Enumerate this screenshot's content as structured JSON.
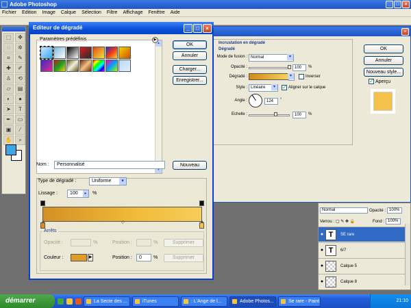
{
  "app": {
    "title": "Adobe Photoshop",
    "menu": [
      "Fichier",
      "Edition",
      "Image",
      "Calque",
      "Sélection",
      "Filtre",
      "Affichage",
      "Fenêtre",
      "Aide"
    ]
  },
  "gradient_editor": {
    "title": "Editeur de dégradé",
    "presets_label": "Paramètres prédéfinis",
    "presets": [
      {
        "colors": [
          "#c9e8ff",
          "#38a6ee"
        ]
      },
      {
        "colors": [
          "#7ab7e0",
          "#ffffff"
        ]
      },
      {
        "colors": [
          "#000000",
          "#ffffff"
        ]
      },
      {
        "colors": [
          "#d62020",
          "#2a2a2a"
        ]
      },
      {
        "colors": [
          "#e04a18",
          "#f1e23c"
        ]
      },
      {
        "colors": [
          "#2830c8",
          "#ef3a14",
          "#f6d23a"
        ]
      },
      {
        "colors": [
          "#f4d200",
          "#d05000"
        ]
      },
      {
        "colors": [
          "#3a2cc8",
          "#e02c8c"
        ]
      },
      {
        "colors": [
          "#d01818",
          "#18a020",
          "#f4d000"
        ]
      },
      {
        "colors": [
          "#6a5a1a",
          "#f0f0e0",
          "#6a5a1a"
        ]
      },
      {
        "colors": [
          "#7a2a10",
          "#f0c080",
          "#7a2a10"
        ]
      },
      {
        "colors": [
          "#ff0000",
          "#ffff00",
          "#00ff00",
          "#00ffff",
          "#0000ff",
          "#ff00ff"
        ]
      },
      {
        "colors": [
          "#ff00a0",
          "#00a0ff",
          "#a0ff00"
        ]
      },
      {
        "colors": [
          "#b8d8f0",
          "#e0f0ff"
        ]
      }
    ],
    "buttons": {
      "ok": "OK",
      "cancel": "Annuler",
      "load": "Charger...",
      "save": "Enregistrer...",
      "new": "Nouveau"
    },
    "name_label": "Nom :",
    "name_value": "Personnalisé",
    "gradient_type_label": "Type de dégradé :",
    "gradient_type_value": "Uniforme",
    "smoothness_label": "Lissage :",
    "smoothness_value": "100",
    "smoothness_unit": "%",
    "stops_title": "Arrêts",
    "opacity_label": "Opacité :",
    "opacity_unit": "%",
    "location_label": "Position :",
    "location_unit": "%",
    "delete_label": "Supprimer",
    "color_label": "Couleur :",
    "color_location_value": "0",
    "stop_color": "#e09c28"
  },
  "layer_style": {
    "section": "Incrustation en dégradé",
    "subsection": "Dégradé",
    "blend_mode_label": "Mode de fusion :",
    "blend_mode_value": "Normal",
    "opacity_label": "Opacité :",
    "opacity_value": "100",
    "gradient_label": "Dégradé :",
    "reverse_label": "Inverser",
    "style_label": "Style :",
    "style_value": "Linéaire",
    "align_label": "Aligner sur le calque",
    "angle_label": "Angle :",
    "angle_value": "124",
    "angle_unit": "°",
    "scale_label": "Echelle :",
    "scale_value": "100",
    "percent": "%",
    "buttons": {
      "ok": "OK",
      "cancel": "Annuler",
      "new_style": "Nouveau style...",
      "preview": "Aperçu"
    }
  },
  "layers_panel": {
    "blend_mode": "Normal",
    "opacity_label": "Opacité :",
    "opacity_value": "100%",
    "lock_label": "Verrou :",
    "fill_label": "Fond :",
    "fill_value": "100%",
    "layers": [
      {
        "name": "SE rare",
        "type": "text",
        "selected": true
      },
      {
        "name": "6/7",
        "type": "text",
        "selected": false
      },
      {
        "name": "Calque 5",
        "type": "raster",
        "selected": false
      },
      {
        "name": "Calque 8",
        "type": "raster",
        "selected": false
      }
    ]
  },
  "taskbar": {
    "start": "démarrer",
    "items": [
      {
        "label": "La Secte des ..."
      },
      {
        "label": "iTunes"
      },
      {
        "label": ": L'Ange de l..."
      },
      {
        "label": "Adobe Photos..."
      },
      {
        "label": "Se rare - Paint"
      }
    ],
    "clock": "21:10"
  }
}
